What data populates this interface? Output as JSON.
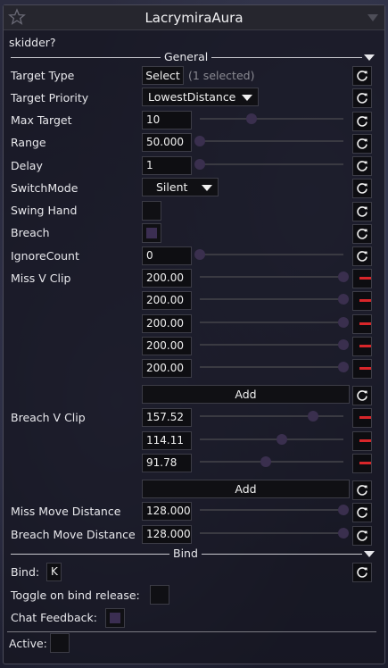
{
  "window": {
    "title": "LacrymiraAura"
  },
  "description": "skidder?",
  "sections": {
    "general": "General",
    "bind": "Bind"
  },
  "general": {
    "target_type": {
      "label": "Target Type",
      "button": "Select",
      "hint": "(1 selected)"
    },
    "target_priority": {
      "label": "Target Priority",
      "value": "LowestDistance"
    },
    "max_target": {
      "label": "Max Target",
      "value": "10",
      "fraction": 0.36
    },
    "range": {
      "label": "Range",
      "value": "50.000",
      "fraction": 0.0
    },
    "delay": {
      "label": "Delay",
      "value": "1",
      "fraction": 0.0
    },
    "switch_mode": {
      "label": "SwitchMode",
      "value": "Silent"
    },
    "swing_hand": {
      "label": "Swing Hand",
      "checked": false
    },
    "breach": {
      "label": "Breach",
      "checked": true
    },
    "ignore_count": {
      "label": "IgnoreCount",
      "value": "0",
      "fraction": 0.0
    },
    "miss_v_clip": {
      "label": "Miss V Clip",
      "values": [
        "200.00",
        "200.00",
        "200.00",
        "200.00",
        "200.00"
      ],
      "fractions": [
        1.0,
        1.0,
        1.0,
        1.0,
        1.0
      ],
      "add_label": "Add"
    },
    "breach_v_clip": {
      "label": "Breach V Clip",
      "values": [
        "157.52",
        "114.11",
        "91.78"
      ],
      "fractions": [
        0.79,
        0.57,
        0.46
      ],
      "add_label": "Add"
    },
    "miss_move_distance": {
      "label": "Miss Move Distance",
      "value": "128.000",
      "fraction": 1.0
    },
    "breach_move_distance": {
      "label": "Breach Move Distance",
      "value": "128.000",
      "fraction": 1.0
    }
  },
  "bind": {
    "bind_label": "Bind:",
    "bind_key": "K",
    "toggle_release_label": "Toggle on bind release:",
    "toggle_release_checked": false,
    "chat_feedback_label": "Chat Feedback:",
    "chat_feedback_checked": true
  },
  "active": {
    "label": "Active:",
    "checked": false
  },
  "colors": {
    "remove": "#d8262a",
    "knob": "#3a2f4e",
    "check_fill": "#3b2e52"
  },
  "icons": {
    "reset": "reset-icon",
    "remove": "minus-icon",
    "favorite": "star-icon",
    "collapse": "triangle-down-icon"
  }
}
